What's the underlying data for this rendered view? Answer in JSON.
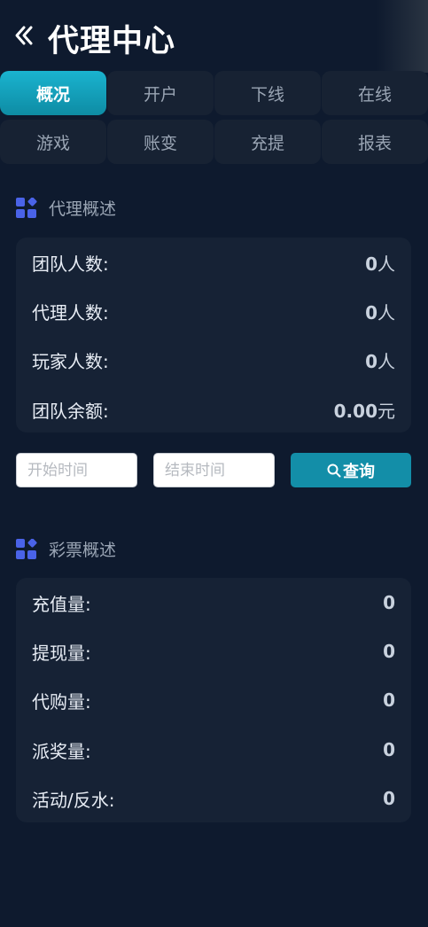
{
  "header": {
    "title": "代理中心",
    "back_icon": "chevron-double-left-icon"
  },
  "tabs": [
    {
      "label": "概况",
      "active": true
    },
    {
      "label": "开户"
    },
    {
      "label": "下线"
    },
    {
      "label": "在线"
    },
    {
      "label": "游戏"
    },
    {
      "label": "账变"
    },
    {
      "label": "充提"
    },
    {
      "label": "报表"
    }
  ],
  "agent_overview": {
    "title": "代理概述",
    "icon": "dashboard-icon",
    "rows": [
      {
        "label": "团队人数:",
        "value": "0",
        "unit": "人"
      },
      {
        "label": "代理人数:",
        "value": "0",
        "unit": "人"
      },
      {
        "label": "玩家人数:",
        "value": "0",
        "unit": "人"
      },
      {
        "label": "团队余额:",
        "value": "0.00",
        "unit": "元"
      }
    ]
  },
  "filter": {
    "start_placeholder": "开始时间",
    "end_placeholder": "结束时间",
    "query_label": "查询"
  },
  "lottery_overview": {
    "title": "彩票概述",
    "icon": "dashboard-icon",
    "rows": [
      {
        "label": "充值量:",
        "value": "0"
      },
      {
        "label": "提现量:",
        "value": "0"
      },
      {
        "label": "代购量:",
        "value": "0"
      },
      {
        "label": "派奖量:",
        "value": "0"
      },
      {
        "label": "活动/反水:",
        "value": "0"
      }
    ]
  },
  "colors": {
    "background": "#0e1a2e",
    "card": "#162235",
    "accent": "#138ea8",
    "icon_blue": "#4a63e8"
  }
}
